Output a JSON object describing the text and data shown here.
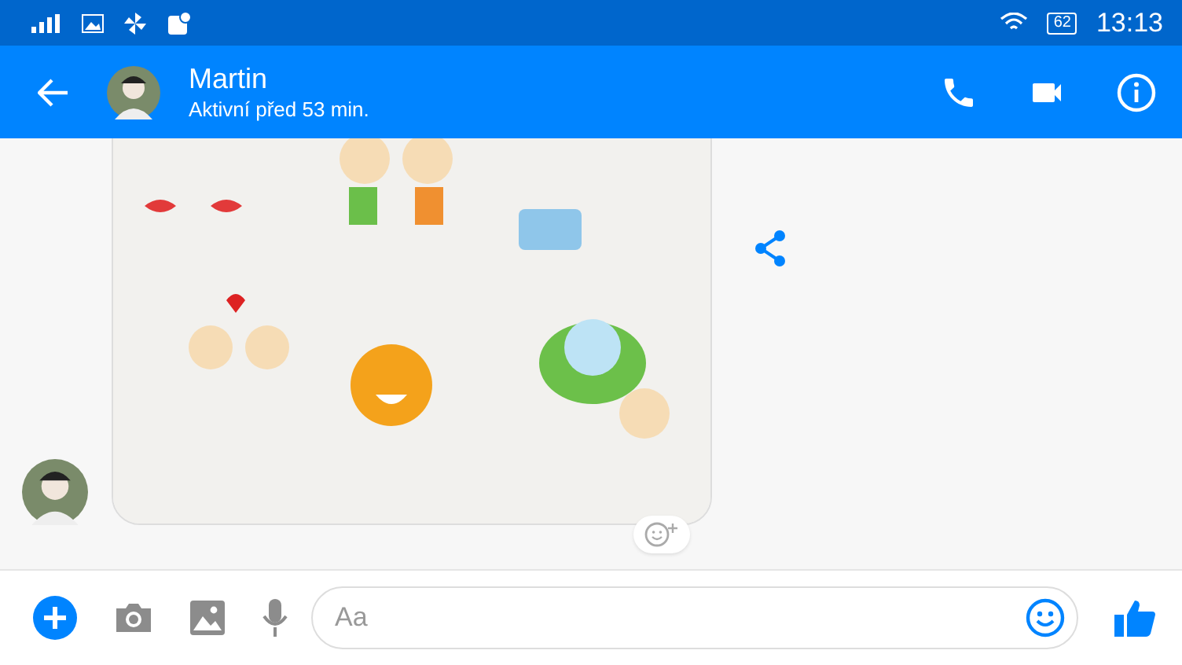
{
  "status_bar": {
    "battery": "62",
    "time": "13:13"
  },
  "header": {
    "name": "Martin",
    "status": "Aktivní před 53 min."
  },
  "composer": {
    "placeholder": "Aa"
  }
}
